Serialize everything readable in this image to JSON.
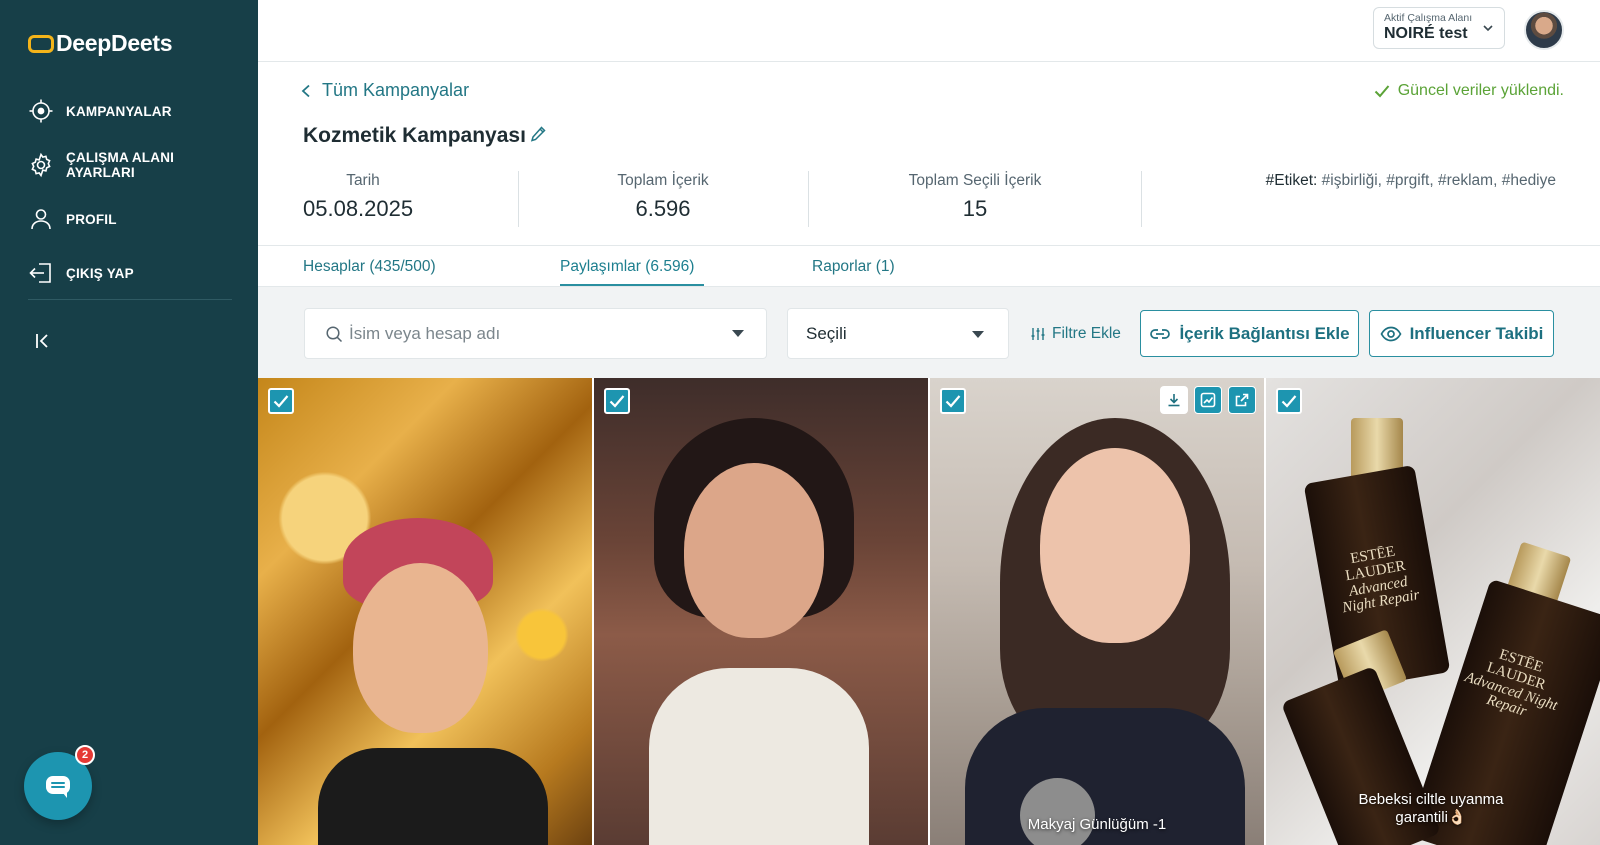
{
  "app": {
    "logo_text": "DeepDeets"
  },
  "sidebar": {
    "items": [
      {
        "label": "KAMPANYALAR",
        "icon": "target-icon"
      },
      {
        "label": "ÇALIŞMA ALANI AYARLARI",
        "icon": "gear-icon"
      },
      {
        "label": "PROFIL",
        "icon": "user-icon"
      },
      {
        "label": "ÇIKIŞ YAP",
        "icon": "logout-icon"
      }
    ],
    "collapse_icon": "collapse-sidebar-icon",
    "chat_badge": "2"
  },
  "topbar": {
    "workspace_label": "Aktif Çalışma Alanı",
    "workspace_name": "NOIRÉ test"
  },
  "header": {
    "back_link": "Tüm Kampanyalar",
    "status_text": "Güncel veriler yüklendi.",
    "campaign_title": "Kozmetik Kampanyası",
    "stats": [
      {
        "label": "Tarih",
        "value": "05.08.2025"
      },
      {
        "label": "Toplam İçerik",
        "value": "6.596"
      },
      {
        "label": "Toplam Seçili İçerik",
        "value": "15"
      }
    ],
    "tags_label": "#Etiket:",
    "tags_value": " #işbirliği, #prgift, #reklam, #hediye"
  },
  "tabs": [
    {
      "label": "Hesaplar (435/500)",
      "active": false
    },
    {
      "label": "Paylaşımlar (6.596)",
      "active": true
    },
    {
      "label": "Raporlar (1)",
      "active": false
    }
  ],
  "filters": {
    "search_placeholder": "İsim veya hesap adı",
    "select_value": "Seçili",
    "filter_add": "Filtre Ekle",
    "content_link_button": "İçerik Bağlantısı Ekle",
    "influencer_button": "Influencer Takibi"
  },
  "posts": [
    {
      "checked": true,
      "caption": ""
    },
    {
      "checked": true,
      "caption": ""
    },
    {
      "checked": true,
      "caption": "Makyaj Günlüğüm -1"
    },
    {
      "checked": true,
      "caption": "Bebeksi ciltle uyanma garantili👌🏻"
    }
  ],
  "colors": {
    "sidebar_bg": "#173f48",
    "accent": "#1d95b0",
    "link": "#237785",
    "success": "#5ba337",
    "logo_accent": "#f4b41a"
  }
}
